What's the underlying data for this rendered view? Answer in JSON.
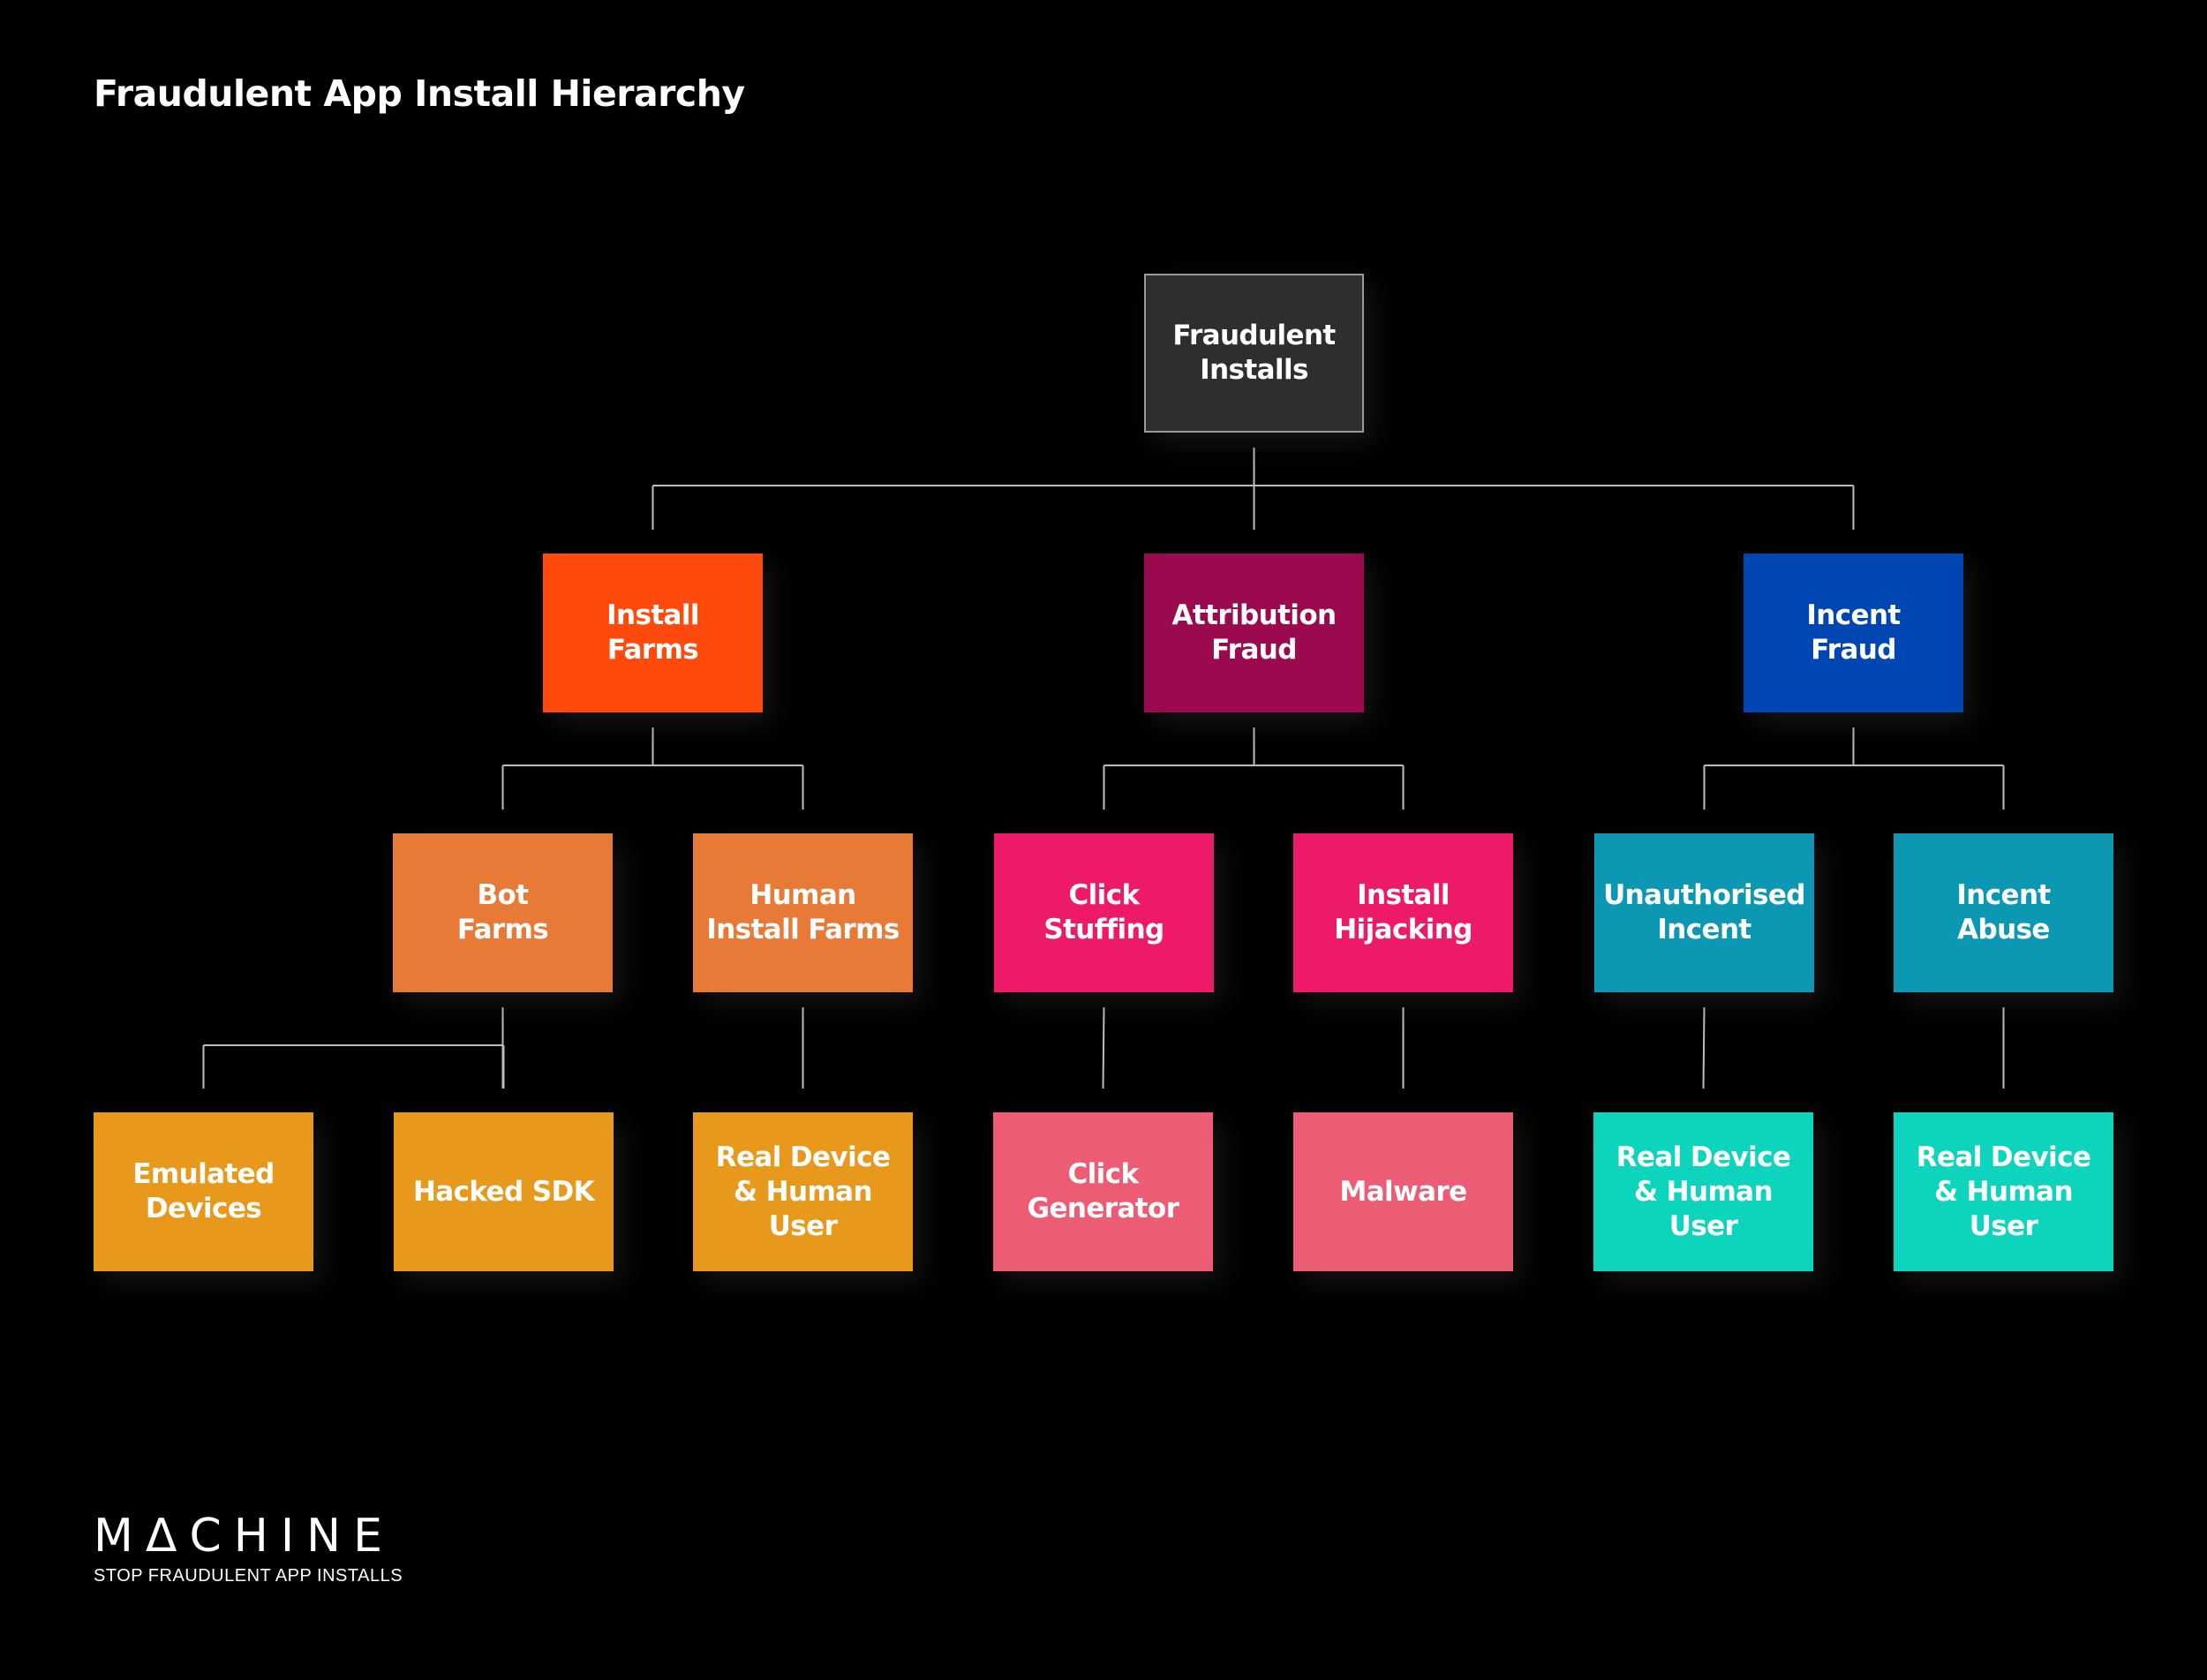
{
  "title": "Fraudulent App Install Hierarchy",
  "colors": {
    "background": "#000000",
    "connector": "#bdbdbd",
    "root": "#2e2e2e",
    "install_farms": "#ff4a0d",
    "attribution_fraud": "#9b0a4e",
    "incent_fraud": "#0046b3",
    "farms_children": "#e87a38",
    "attribution_children": "#ec1a68",
    "incent_children": "#0c98b3",
    "farms_leaves": "#e8981a",
    "attribution_leaves": "#ec5c74",
    "incent_leaves": "#0dd5bd"
  },
  "tree": {
    "id": "root",
    "label": "Fraudulent\nInstalls",
    "color": "root",
    "children": [
      {
        "id": "install-farms",
        "label": "Install\nFarms",
        "color": "install_farms",
        "children": [
          {
            "id": "bot-farms",
            "label": "Bot\nFarms",
            "color": "farms_children",
            "children": [
              {
                "id": "emulated-devices",
                "label": "Emulated\nDevices",
                "color": "farms_leaves"
              },
              {
                "id": "hacked-sdk",
                "label": "Hacked SDK",
                "color": "farms_leaves"
              }
            ]
          },
          {
            "id": "human-install-farms",
            "label": "Human\nInstall Farms",
            "color": "farms_children",
            "children": [
              {
                "id": "real-device-human-user-1",
                "label": "Real Device\n& Human User",
                "color": "farms_leaves"
              }
            ]
          }
        ]
      },
      {
        "id": "attribution-fraud",
        "label": "Attribution\nFraud",
        "color": "attribution_fraud",
        "children": [
          {
            "id": "click-stuffing",
            "label": "Click\nStuffing",
            "color": "attribution_children",
            "children": [
              {
                "id": "click-generator",
                "label": "Click\nGenerator",
                "color": "attribution_leaves"
              }
            ]
          },
          {
            "id": "install-hijacking",
            "label": "Install\nHijacking",
            "color": "attribution_children",
            "children": [
              {
                "id": "malware",
                "label": "Malware",
                "color": "attribution_leaves"
              }
            ]
          }
        ]
      },
      {
        "id": "incent-fraud",
        "label": "Incent\nFraud",
        "color": "incent_fraud",
        "children": [
          {
            "id": "unauthorised-incent",
            "label": "Unauthorised\nIncent",
            "color": "incent_children",
            "children": [
              {
                "id": "real-device-human-user-2",
                "label": "Real Device\n& Human User",
                "color": "incent_leaves"
              }
            ]
          },
          {
            "id": "incent-abuse",
            "label": "Incent\nAbuse",
            "color": "incent_children",
            "children": [
              {
                "id": "real-device-human-user-3",
                "label": "Real Device\n& Human User",
                "color": "incent_leaves"
              }
            ]
          }
        ]
      }
    ]
  },
  "logo": {
    "wordmark": "MACHINE",
    "tagline": "STOP FRAUDULENT APP INSTALLS"
  }
}
